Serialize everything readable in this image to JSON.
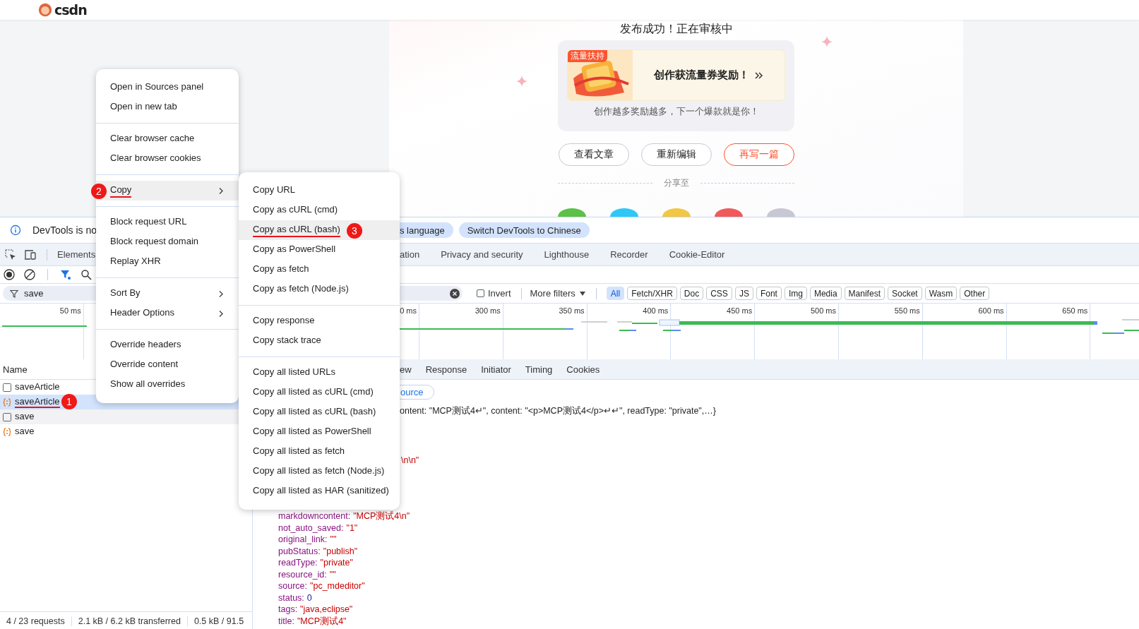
{
  "web_page": {
    "logo": "csdn",
    "heading": "发布成功！正在审核中",
    "promo": {
      "tag": "流量扶持",
      "title": "创作获流量券奖励！",
      "subtitle": "创作越多奖励越多，下一个爆款就是你！"
    },
    "actions": [
      {
        "label": "查看文章",
        "kind": "outline"
      },
      {
        "label": "重新编辑",
        "kind": "outline"
      },
      {
        "label": "再写一篇",
        "kind": "primary"
      }
    ],
    "share_label": "分享至",
    "share_buttons": [
      {
        "color": "#5cc146"
      },
      {
        "color": "#2ec8f8"
      },
      {
        "color": "#f2c744"
      },
      {
        "color": "#f05a5a"
      },
      {
        "color": "#c8c8d2"
      }
    ]
  },
  "devtools": {
    "info_bar": {
      "message": "DevTools is no",
      "buttons": [
        "s language",
        "Switch DevTools to Chinese"
      ]
    },
    "panel_tabs_left": [
      "Elements"
    ],
    "panel_tabs_right": [
      "ation",
      "Privacy and security",
      "Lighthouse",
      "Recorder",
      "Cookie-Editor"
    ],
    "filter": {
      "value": "save",
      "invert": {
        "label": "Invert",
        "checked": false
      },
      "more_filters": "More filters",
      "types": [
        {
          "label": "All",
          "selected": true
        },
        {
          "label": "Fetch/XHR",
          "selected": false
        },
        {
          "label": "Doc",
          "selected": false
        },
        {
          "label": "CSS",
          "selected": false
        },
        {
          "label": "JS",
          "selected": false
        },
        {
          "label": "Font",
          "selected": false
        },
        {
          "label": "Img",
          "selected": false
        },
        {
          "label": "Media",
          "selected": false
        },
        {
          "label": "Manifest",
          "selected": false
        },
        {
          "label": "Socket",
          "selected": false
        },
        {
          "label": "Wasm",
          "selected": false
        },
        {
          "label": "Other",
          "selected": false
        }
      ]
    },
    "timeline": {
      "ticks_left": [
        "50 ms"
      ],
      "ticks_right": [
        "0 ms",
        "300 ms",
        "350 ms",
        "400 ms",
        "450 ms",
        "500 ms",
        "550 ms",
        "600 ms",
        "650 ms"
      ]
    },
    "requests": {
      "column": "Name",
      "rows": [
        {
          "name": "saveArticle",
          "kind": "document",
          "selected": false,
          "hovered": false
        },
        {
          "name": "saveArticle",
          "kind": "xhr",
          "selected": true,
          "hovered": false,
          "badge": "1"
        },
        {
          "name": "save",
          "kind": "document",
          "selected": false,
          "hovered": true
        },
        {
          "name": "save",
          "kind": "xhr",
          "selected": false,
          "hovered": false
        }
      ]
    },
    "status_bar": [
      "4 / 23 requests",
      "2.1 kB / 6.2 kB transferred",
      "0.5 kB / 91.5"
    ],
    "detail": {
      "tabs": [
        "ew",
        "Response",
        "Initiator",
        "Timing",
        "Cookies"
      ],
      "view_source": "ource",
      "summary": "ontent: \"MCP测试4↵\", content: \"<p>MCP测试4</p>↵↵\", readType: \"private\",…}",
      "fragment": "\\n\\n\"",
      "fields": [
        {
          "key": "markdowncontent:",
          "value": "\"MCP测试4\\n\"",
          "kind": "string"
        },
        {
          "key": "not_auto_saved:",
          "value": "\"1\"",
          "kind": "string"
        },
        {
          "key": "original_link:",
          "value": "\"\"",
          "kind": "string"
        },
        {
          "key": "pubStatus:",
          "value": "\"publish\"",
          "kind": "string"
        },
        {
          "key": "readType:",
          "value": "\"private\"",
          "kind": "string"
        },
        {
          "key": "resource_id:",
          "value": "\"\"",
          "kind": "string"
        },
        {
          "key": "source:",
          "value": "\"pc_mdeditor\"",
          "kind": "string"
        },
        {
          "key": "status:",
          "value": "0",
          "kind": "number"
        },
        {
          "key": "tags:",
          "value": "\"java,eclipse\"",
          "kind": "string"
        },
        {
          "key": "title:",
          "value": "\"MCP测试4\"",
          "kind": "string"
        }
      ]
    }
  },
  "context_menu": {
    "groups": [
      {
        "items": [
          {
            "label": "Open in Sources panel",
            "submenu": false,
            "highlighted": false
          },
          {
            "label": "Open in new tab",
            "submenu": false,
            "highlighted": false
          }
        ]
      },
      {
        "items": [
          {
            "label": "Clear browser cache",
            "submenu": false,
            "highlighted": false
          },
          {
            "label": "Clear browser cookies",
            "submenu": false,
            "highlighted": false
          }
        ]
      },
      {
        "items": [
          {
            "label": "Copy",
            "submenu": true,
            "highlighted": true,
            "badge": "2"
          }
        ]
      },
      {
        "items": [
          {
            "label": "Block request URL",
            "submenu": false,
            "highlighted": false
          },
          {
            "label": "Block request domain",
            "submenu": false,
            "highlighted": false
          },
          {
            "label": "Replay XHR",
            "submenu": false,
            "highlighted": false
          }
        ]
      },
      {
        "items": [
          {
            "label": "Sort By",
            "submenu": true,
            "highlighted": false
          },
          {
            "label": "Header Options",
            "submenu": true,
            "highlighted": false
          }
        ]
      },
      {
        "items": [
          {
            "label": "Override headers",
            "submenu": false,
            "highlighted": false
          },
          {
            "label": "Override content",
            "submenu": false,
            "highlighted": false
          },
          {
            "label": "Show all overrides",
            "submenu": false,
            "highlighted": false
          }
        ]
      }
    ]
  },
  "copy_submenu": {
    "groups": [
      {
        "items": [
          {
            "label": "Copy URL",
            "highlighted": false
          },
          {
            "label": "Copy as cURL (cmd)",
            "highlighted": false
          },
          {
            "label": "Copy as cURL (bash)",
            "highlighted": true,
            "badge": "3"
          },
          {
            "label": "Copy as PowerShell",
            "highlighted": false
          },
          {
            "label": "Copy as fetch",
            "highlighted": false
          },
          {
            "label": "Copy as fetch (Node.js)",
            "highlighted": false
          }
        ]
      },
      {
        "items": [
          {
            "label": "Copy response",
            "highlighted": false
          },
          {
            "label": "Copy stack trace",
            "highlighted": false
          }
        ]
      },
      {
        "items": [
          {
            "label": "Copy all listed URLs",
            "highlighted": false
          },
          {
            "label": "Copy all listed as cURL (cmd)",
            "highlighted": false
          },
          {
            "label": "Copy all listed as cURL (bash)",
            "highlighted": false
          },
          {
            "label": "Copy all listed as PowerShell",
            "highlighted": false
          },
          {
            "label": "Copy all listed as fetch",
            "highlighted": false
          },
          {
            "label": "Copy all listed as fetch (Node.js)",
            "highlighted": false
          },
          {
            "label": "Copy all listed as HAR (sanitized)",
            "highlighted": false
          }
        ]
      }
    ]
  }
}
